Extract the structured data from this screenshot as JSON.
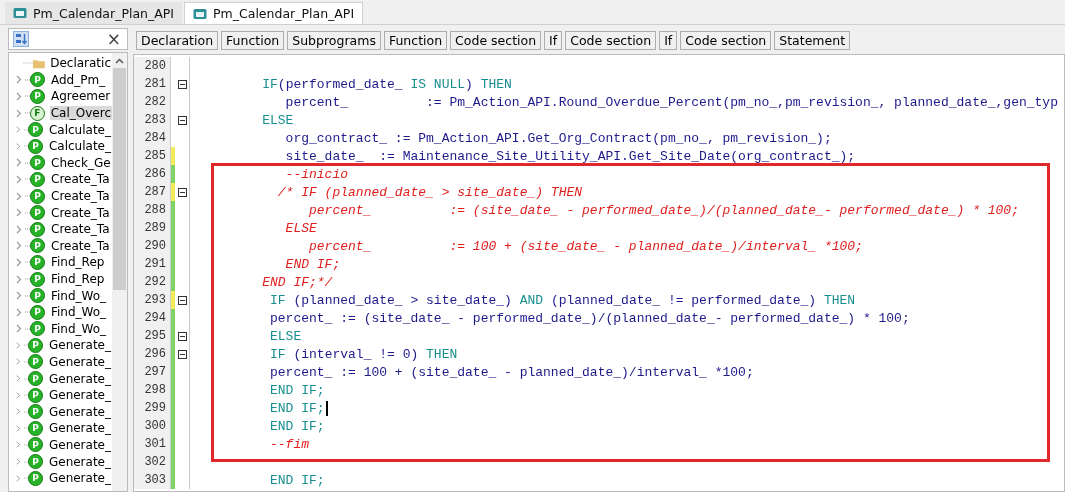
{
  "tabs": [
    {
      "label": "Pm_Calendar_Plan_API",
      "selected": false
    },
    {
      "label": "Pm_Calendar_Plan_API",
      "selected": true
    }
  ],
  "outline": {
    "close": "×",
    "items": [
      {
        "label": "Declaratic",
        "kind": "folder",
        "selected": false
      },
      {
        "label": "Add_Pm_",
        "kind": "item",
        "badge": "P",
        "selected": false
      },
      {
        "label": "Agreemer",
        "kind": "item",
        "badge": "P",
        "selected": false
      },
      {
        "label": "Cal_Overc",
        "kind": "item",
        "badge": "F",
        "selected": true
      },
      {
        "label": "Calculate_",
        "kind": "item",
        "badge": "P",
        "selected": false
      },
      {
        "label": "Calculate_",
        "kind": "item",
        "badge": "P",
        "selected": false
      },
      {
        "label": "Check_Ge",
        "kind": "item",
        "badge": "P",
        "selected": false
      },
      {
        "label": "Create_Ta",
        "kind": "item",
        "badge": "P",
        "selected": false
      },
      {
        "label": "Create_Ta",
        "kind": "item",
        "badge": "P",
        "selected": false
      },
      {
        "label": "Create_Ta",
        "kind": "item",
        "badge": "P",
        "selected": false
      },
      {
        "label": "Create_Ta",
        "kind": "item",
        "badge": "P",
        "selected": false
      },
      {
        "label": "Create_Ta",
        "kind": "item",
        "badge": "P",
        "selected": false
      },
      {
        "label": "Find_Rep",
        "kind": "item",
        "badge": "P",
        "selected": false
      },
      {
        "label": "Find_Rep",
        "kind": "item",
        "badge": "P",
        "selected": false
      },
      {
        "label": "Find_Wo_",
        "kind": "item",
        "badge": "P",
        "selected": false
      },
      {
        "label": "Find_Wo_",
        "kind": "item",
        "badge": "P",
        "selected": false
      },
      {
        "label": "Find_Wo_",
        "kind": "item",
        "badge": "P",
        "selected": false
      },
      {
        "label": "Generate_",
        "kind": "item",
        "badge": "P",
        "selected": false
      },
      {
        "label": "Generate_",
        "kind": "item",
        "badge": "P",
        "selected": false
      },
      {
        "label": "Generate_",
        "kind": "item",
        "badge": "P",
        "selected": false
      },
      {
        "label": "Generate_",
        "kind": "item",
        "badge": "P",
        "selected": false
      },
      {
        "label": "Generate_",
        "kind": "item",
        "badge": "P",
        "selected": false
      },
      {
        "label": "Generate_",
        "kind": "item",
        "badge": "P",
        "selected": false
      },
      {
        "label": "Generate_",
        "kind": "item",
        "badge": "P",
        "selected": false
      },
      {
        "label": "Generate_",
        "kind": "item",
        "badge": "P",
        "selected": false
      },
      {
        "label": "Generate_",
        "kind": "item",
        "badge": "P",
        "selected": false
      }
    ]
  },
  "breadcrumbs": [
    "Declaration",
    "Function",
    "Subprograms",
    "Function",
    "Code section",
    "If",
    "Code section",
    "If",
    "Code section",
    "Statement"
  ],
  "editor": {
    "lines": [
      {
        "number": "280",
        "fold": false,
        "cursor": false
      },
      {
        "number": "281",
        "fold": true,
        "cursor": false,
        "segments": [
          {
            "text": "         IF",
            "kind": "kw"
          },
          {
            "text": "(performed_date_ ",
            "kind": "id"
          },
          {
            "text": "IS NULL",
            "kind": "kw"
          },
          {
            "text": ") ",
            "kind": "id"
          },
          {
            "text": "THEN",
            "kind": "kw"
          }
        ]
      },
      {
        "number": "282",
        "fold": false,
        "cursor": false,
        "segments": [
          {
            "text": "            percent_          := Pm_Action_API.Round_Overdue_Percent(pm_no_,pm_revision_, planned_date_,gen_typ",
            "kind": "id"
          }
        ]
      },
      {
        "number": "283",
        "fold": true,
        "cursor": false,
        "segments": [
          {
            "text": "         ELSE",
            "kind": "kw"
          }
        ]
      },
      {
        "number": "284",
        "fold": false,
        "cursor": false,
        "segments": [
          {
            "text": "            org_contract_ := Pm_Action_API.Get_Org_Contract(pm_no_, pm_revision_);",
            "kind": "id"
          }
        ]
      },
      {
        "number": "285",
        "color": "#f2ec5a",
        "fold": false,
        "cursor": false,
        "segments": [
          {
            "text": "            site_date_  := Maintenance_Site_Utility_API.Get_Site_Date(org_contract_);",
            "kind": "id"
          }
        ]
      },
      {
        "number": "286",
        "color": "#7ed46a",
        "fold": false,
        "cursor": false,
        "segments": [
          {
            "text": "            --inicio",
            "kind": "cm"
          }
        ]
      },
      {
        "number": "287",
        "color": "#f2ec5a",
        "fold": true,
        "cursor": false,
        "segments": [
          {
            "text": "           /* IF (planned_date_ > site_date_) THEN",
            "kind": "cm"
          }
        ]
      },
      {
        "number": "288",
        "color": "#7ed46a",
        "fold": false,
        "cursor": false,
        "segments": [
          {
            "text": "               percent_          := (site_date_ - performed_date_)/(planned_date_- performed_date_) * 100;",
            "kind": "cm"
          }
        ]
      },
      {
        "number": "289",
        "color": "#7ed46a",
        "fold": false,
        "cursor": false,
        "segments": [
          {
            "text": "            ELSE",
            "kind": "cm"
          }
        ]
      },
      {
        "number": "290",
        "color": "#7ed46a",
        "fold": false,
        "cursor": false,
        "segments": [
          {
            "text": "               percent_          := 100 + (site_date_ - planned_date_)/interval_ *100;",
            "kind": "cm"
          }
        ]
      },
      {
        "number": "291",
        "color": "#7ed46a",
        "fold": false,
        "cursor": false,
        "segments": [
          {
            "text": "            END IF;",
            "kind": "cm"
          }
        ]
      },
      {
        "number": "292",
        "color": "#7ed46a",
        "fold": false,
        "cursor": false,
        "segments": [
          {
            "text": "         END IF;*/",
            "kind": "cm"
          }
        ]
      },
      {
        "number": "293",
        "color": "#f2ec5a",
        "fold": true,
        "cursor": false,
        "segments": [
          {
            "text": "          IF",
            "kind": "kw"
          },
          {
            "text": " (planned_date_ > site_date_) ",
            "kind": "id"
          },
          {
            "text": "AND",
            "kind": "kw"
          },
          {
            "text": " (planned_date_ != performed_date_) ",
            "kind": "id"
          },
          {
            "text": "THEN",
            "kind": "kw"
          }
        ]
      },
      {
        "number": "294",
        "color": "#7ed46a",
        "fold": false,
        "cursor": false,
        "segments": [
          {
            "text": "          percent_ := (site_date_ - performed_date_)/(planned_date_- performed_date_) * 100;",
            "kind": "id"
          }
        ]
      },
      {
        "number": "295",
        "color": "#7ed46a",
        "fold": true,
        "cursor": false,
        "segments": [
          {
            "text": "          ELSE",
            "kind": "kw"
          }
        ]
      },
      {
        "number": "296",
        "color": "#7ed46a",
        "fold": true,
        "cursor": false,
        "segments": [
          {
            "text": "          IF",
            "kind": "kw"
          },
          {
            "text": " (interval_ != 0) ",
            "kind": "id"
          },
          {
            "text": "THEN",
            "kind": "kw"
          }
        ]
      },
      {
        "number": "297",
        "color": "#7ed46a",
        "fold": false,
        "cursor": false,
        "segments": [
          {
            "text": "          percent_ := 100 + (site_date_ - planned_date_)/interval_ *100;",
            "kind": "id"
          }
        ]
      },
      {
        "number": "298",
        "color": "#7ed46a",
        "fold": false,
        "cursor": false,
        "segments": [
          {
            "text": "          END IF;",
            "kind": "kw"
          }
        ]
      },
      {
        "number": "299",
        "color": "#7ed46a",
        "fold": false,
        "cursor": true,
        "segments": [
          {
            "text": "          END IF;",
            "kind": "kw"
          }
        ]
      },
      {
        "number": "300",
        "color": "#7ed46a",
        "fold": false,
        "cursor": false,
        "segments": [
          {
            "text": "          END IF;",
            "kind": "kw"
          }
        ]
      },
      {
        "number": "301",
        "color": "#7ed46a",
        "fold": false,
        "cursor": false,
        "segments": [
          {
            "text": "          --fim",
            "kind": "cm"
          }
        ]
      },
      {
        "number": "302",
        "color": "#7ed46a",
        "fold": false,
        "cursor": false
      },
      {
        "number": "303",
        "color": "#7ed46a",
        "fold": false,
        "cursor": false,
        "segments": [
          {
            "text": "          END IF;",
            "kind": "kw"
          }
        ]
      }
    ]
  }
}
